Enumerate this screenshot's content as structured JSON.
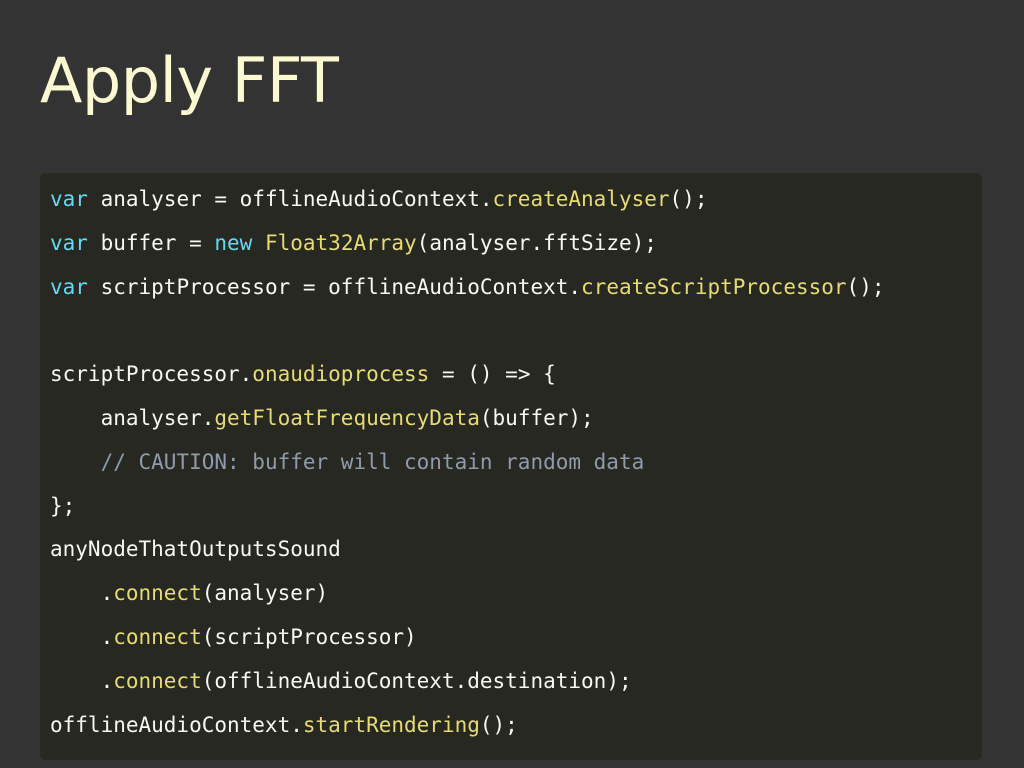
{
  "title": "Apply FFT",
  "colors": {
    "background": "#333333",
    "title": "#fbf8d2",
    "code_background": "#272822",
    "code_text": "#f8f8f2",
    "keyword": "#66d9ef",
    "function": "#e6db74",
    "comment": "#8f9bab"
  },
  "code": {
    "lines": [
      [
        {
          "type": "kw",
          "text": "var"
        },
        {
          "type": "pl",
          "text": " analyser = offlineAudioContext."
        },
        {
          "type": "fn",
          "text": "createAnalyser"
        },
        {
          "type": "pl",
          "text": "();"
        }
      ],
      [
        {
          "type": "kw",
          "text": "var"
        },
        {
          "type": "pl",
          "text": " buffer = "
        },
        {
          "type": "kw",
          "text": "new"
        },
        {
          "type": "pl",
          "text": " "
        },
        {
          "type": "fn",
          "text": "Float32Array"
        },
        {
          "type": "pl",
          "text": "(analyser.fftSize);"
        }
      ],
      [
        {
          "type": "kw",
          "text": "var"
        },
        {
          "type": "pl",
          "text": " scriptProcessor = offlineAudioContext."
        },
        {
          "type": "fn",
          "text": "createScriptProcessor"
        },
        {
          "type": "pl",
          "text": "();"
        }
      ],
      [],
      [
        {
          "type": "pl",
          "text": "scriptProcessor."
        },
        {
          "type": "fn",
          "text": "onaudioprocess"
        },
        {
          "type": "pl",
          "text": " = () => {"
        }
      ],
      [
        {
          "type": "pl",
          "text": "    analyser."
        },
        {
          "type": "fn",
          "text": "getFloatFrequencyData"
        },
        {
          "type": "pl",
          "text": "(buffer);"
        }
      ],
      [
        {
          "type": "pl",
          "text": "    "
        },
        {
          "type": "cm",
          "text": "// CAUTION: buffer will contain random data"
        }
      ],
      [
        {
          "type": "pl",
          "text": "};"
        }
      ],
      [
        {
          "type": "pl",
          "text": "anyNodeThatOutputsSound"
        }
      ],
      [
        {
          "type": "pl",
          "text": "    ."
        },
        {
          "type": "fn",
          "text": "connect"
        },
        {
          "type": "pl",
          "text": "(analyser)"
        }
      ],
      [
        {
          "type": "pl",
          "text": "    ."
        },
        {
          "type": "fn",
          "text": "connect"
        },
        {
          "type": "pl",
          "text": "(scriptProcessor)"
        }
      ],
      [
        {
          "type": "pl",
          "text": "    ."
        },
        {
          "type": "fn",
          "text": "connect"
        },
        {
          "type": "pl",
          "text": "(offlineAudioContext.destination);"
        }
      ],
      [
        {
          "type": "pl",
          "text": "offlineAudioContext."
        },
        {
          "type": "fn",
          "text": "startRendering"
        },
        {
          "type": "pl",
          "text": "();"
        }
      ]
    ]
  }
}
